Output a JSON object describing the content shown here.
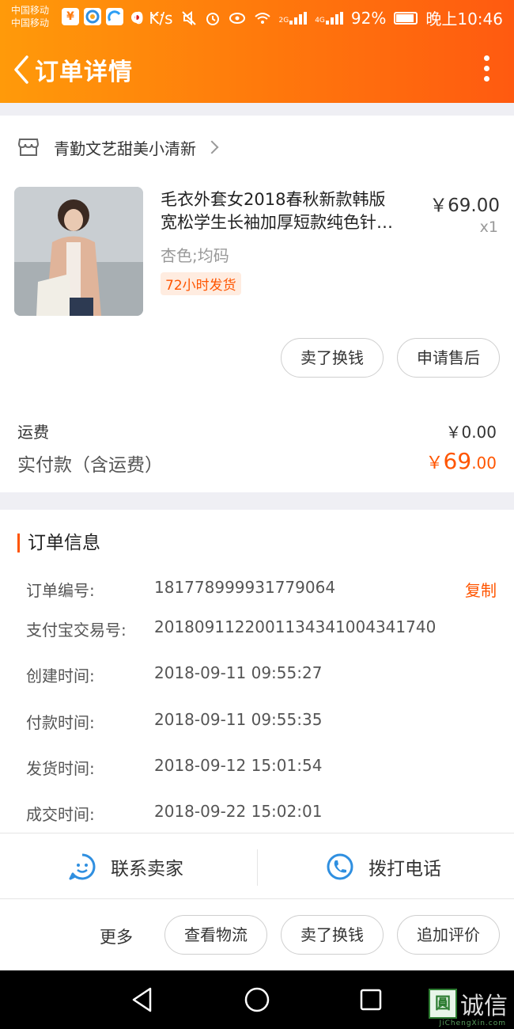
{
  "statusbar": {
    "carrier_1": "中国移动",
    "carrier_2": "中国移动",
    "app_icon_1": "¥",
    "net_speed": "0 K/s",
    "signal_1_label": "2G",
    "signal_2_label": "4G",
    "battery": "92%",
    "time": "晚上10:46"
  },
  "header": {
    "title": "订单详情",
    "back_icon": "chevron-left-icon",
    "menu_icon": "more-vertical-icon",
    "bg_start": "#ff9a0a",
    "bg_end": "#ff5a10"
  },
  "shop": {
    "name": "青勤文艺甜美小清新",
    "icon": "store-icon"
  },
  "product": {
    "name_line1": "毛衣外套女2018春秋新款韩版",
    "name_line2": "宽松学生长袖加厚短款纯色针…",
    "price": "￥69.00",
    "quantity": "x1",
    "spec": "杏色;均码",
    "tag": "72小时发货"
  },
  "item_actions": {
    "sell": "卖了换钱",
    "after_sale": "申请售后"
  },
  "summary": {
    "shipping_label": "运费",
    "shipping_value": "￥0.00",
    "paid_label": "实付款（含运费）",
    "paid_currency": "￥",
    "paid_integer": "69",
    "paid_decimal": ".00"
  },
  "order_info": {
    "title": "订单信息",
    "copy_label": "复制",
    "rows": [
      {
        "label": "订单编号:",
        "value": "181778999931779064"
      },
      {
        "label": "支付宝交易号:",
        "value": "2018091122001134341004341740"
      },
      {
        "label": "创建时间:",
        "value": "2018-09-11 09:55:27"
      },
      {
        "label": "付款时间:",
        "value": "2018-09-11 09:55:35"
      },
      {
        "label": "发货时间:",
        "value": "2018-09-12 15:01:54"
      },
      {
        "label": "成交时间:",
        "value": "2018-09-22 15:02:01"
      }
    ]
  },
  "contact": {
    "seller_label": "联系卖家",
    "phone_label": "拨打电话",
    "accent": "#2f8fe0"
  },
  "bottom_actions": {
    "more": "更多",
    "logistics": "查看物流",
    "sell": "卖了换钱",
    "review": "追加评价"
  },
  "watermark": {
    "mark": "圓",
    "text": "诚信",
    "sub": "JiChengXin.com"
  },
  "accent_color": "#ff5500"
}
